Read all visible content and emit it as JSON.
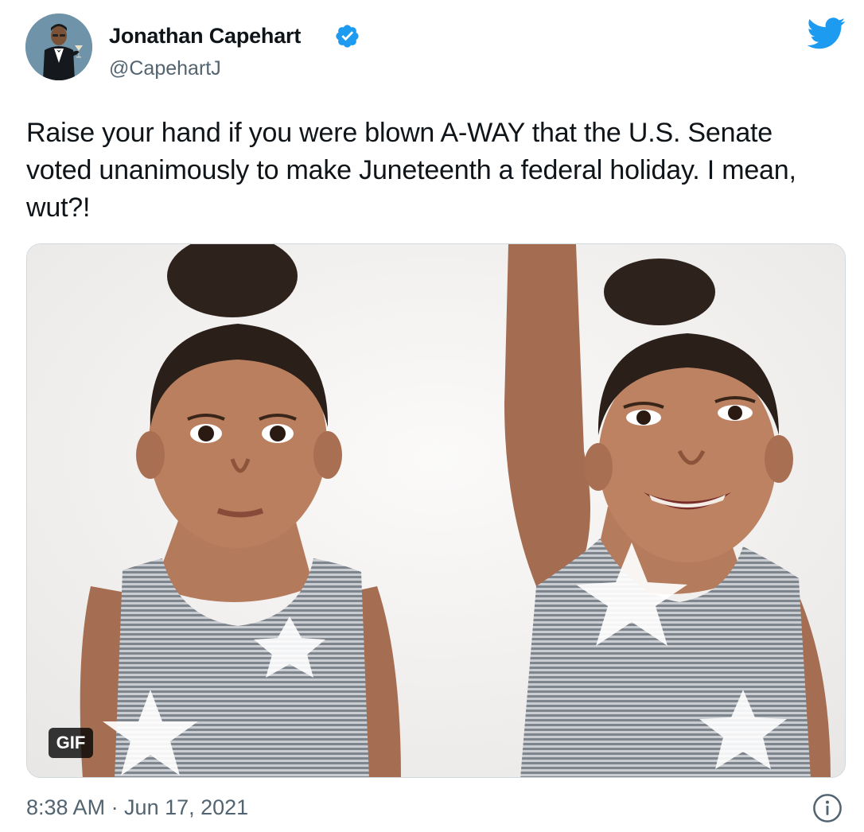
{
  "author": {
    "name": "Jonathan Capehart",
    "handle": "@CapehartJ",
    "verified": true,
    "avatar_icon": "cartoon-man-in-tuxedo-avatar"
  },
  "brand": {
    "icon": "twitter-bird-icon",
    "color": "#1d9bf0"
  },
  "tweet": {
    "text": "Raise your hand if you were blown A-WAY that the U.S. Senate voted unanimously to make Juneteenth a federal holiday. I mean, wut?!"
  },
  "media": {
    "badge": "GIF"
  },
  "footer": {
    "timestamp": "8:38 AM · Jun 17, 2021",
    "info_icon": "info-icon"
  },
  "colors": {
    "text_primary": "#0f1419",
    "text_secondary": "#536471",
    "verified_blue": "#1d9bf0",
    "border": "#cfd9de"
  }
}
